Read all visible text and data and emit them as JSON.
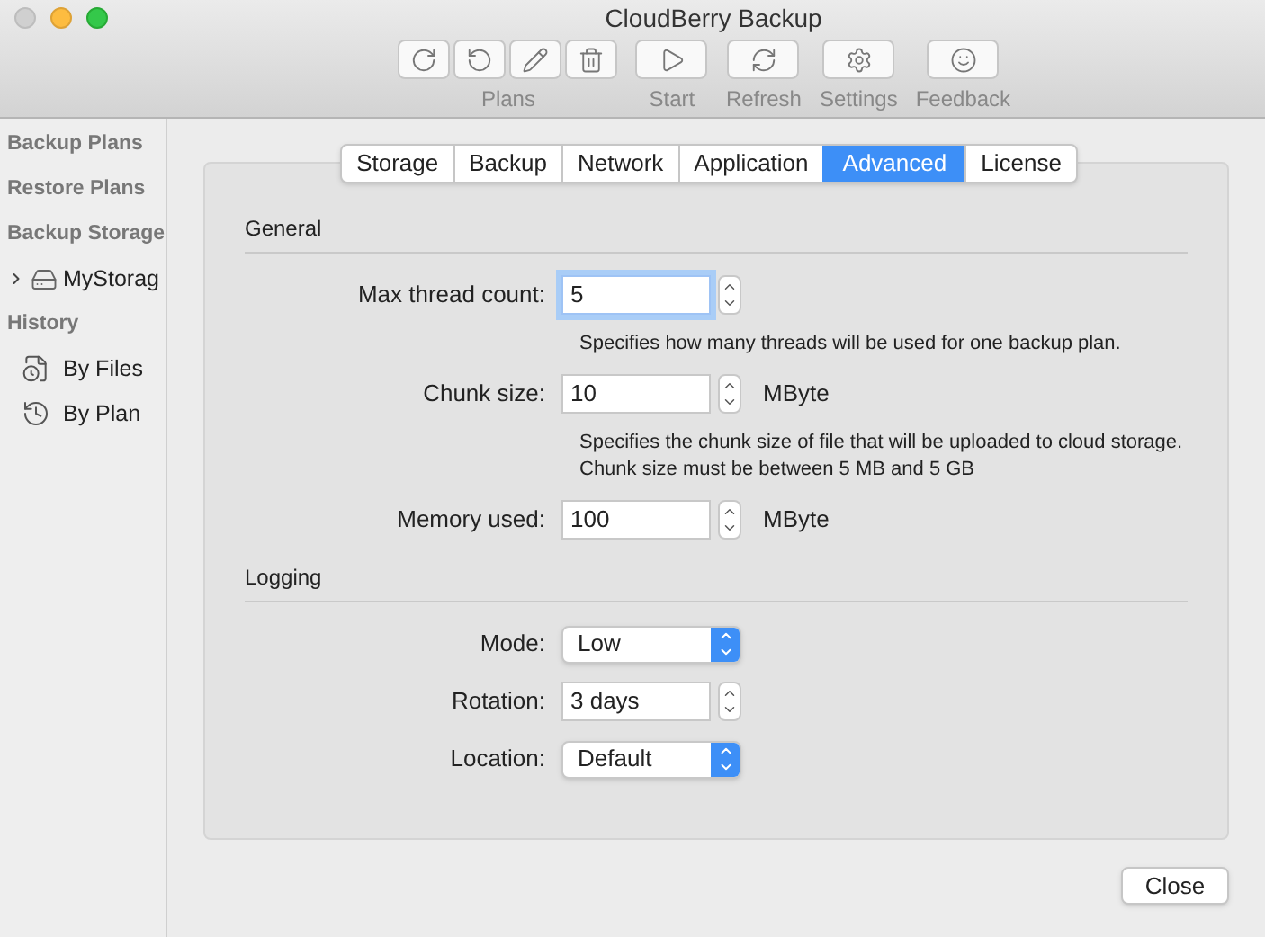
{
  "window": {
    "title": "CloudBerry Backup"
  },
  "toolbar": {
    "groups": [
      {
        "label": "Plans",
        "buttons": [
          {
            "kind": "new-backup"
          },
          {
            "kind": "new-restore"
          },
          {
            "kind": "edit"
          },
          {
            "kind": "delete"
          }
        ]
      },
      {
        "label": "Start",
        "buttons": [
          {
            "kind": "start"
          }
        ]
      },
      {
        "label": "Refresh",
        "buttons": [
          {
            "kind": "refresh"
          }
        ]
      },
      {
        "label": "Settings",
        "buttons": [
          {
            "kind": "settings"
          }
        ]
      },
      {
        "label": "Feedback",
        "buttons": [
          {
            "kind": "feedback"
          }
        ]
      }
    ]
  },
  "sidebar": {
    "items": [
      {
        "kind": "heading",
        "label": "Backup Plans"
      },
      {
        "kind": "heading",
        "label": "Restore Plans"
      },
      {
        "kind": "heading",
        "label": "Backup Storage"
      },
      {
        "kind": "storage",
        "label": "MyStorag",
        "expanded": false
      },
      {
        "kind": "heading",
        "label": "History"
      },
      {
        "kind": "files",
        "label": "By Files"
      },
      {
        "kind": "plan",
        "label": "By Plan"
      }
    ]
  },
  "tabs": [
    {
      "label": "Storage",
      "selected": false
    },
    {
      "label": "Backup",
      "selected": false
    },
    {
      "label": "Network",
      "selected": false
    },
    {
      "label": "Application",
      "selected": false
    },
    {
      "label": "Advanced",
      "selected": true
    },
    {
      "label": "License",
      "selected": false
    }
  ],
  "sections": [
    {
      "title": "General",
      "rows": [
        {
          "kind": "stepper",
          "label": "Max thread count:",
          "value": "5",
          "focused": true,
          "hint": [
            "Specifies how many threads will be used for one backup plan."
          ]
        },
        {
          "kind": "stepper",
          "label": "Chunk size:",
          "value": "10",
          "unit": "MByte",
          "focused": false,
          "hint": [
            "Specifies the chunk size of file that will be uploaded to cloud storage.",
            "Chunk size must be between 5 MB and 5 GB"
          ]
        },
        {
          "kind": "stepper",
          "label": "Memory used:",
          "value": "100",
          "unit": "MByte",
          "focused": false
        }
      ]
    },
    {
      "title": "Logging",
      "rows": [
        {
          "kind": "select",
          "label": "Mode:",
          "value": "Low"
        },
        {
          "kind": "stepper",
          "label": "Rotation:",
          "value": "3 days",
          "focused": false
        },
        {
          "kind": "select",
          "label": "Location:",
          "value": "Default"
        }
      ]
    }
  ],
  "buttons": [
    "Close"
  ]
}
